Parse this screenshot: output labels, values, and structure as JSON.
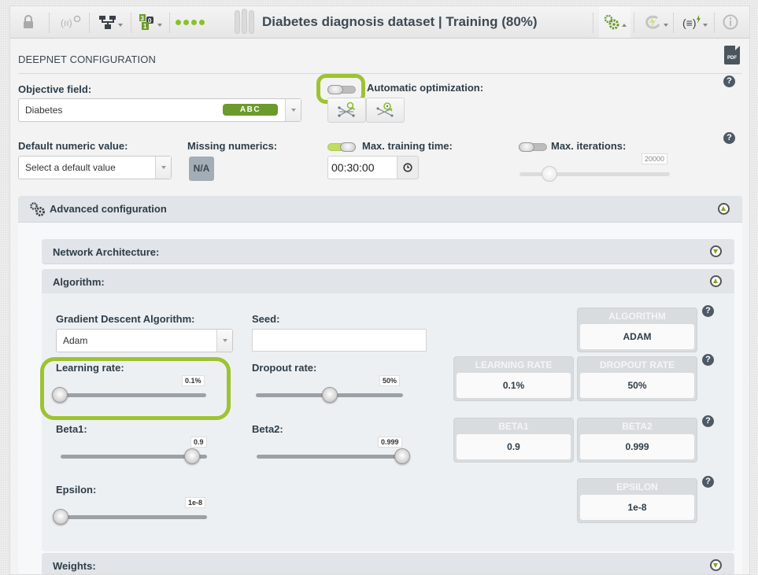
{
  "toolbar": {
    "title": "Diabetes diagnosis dataset | Training (80%)",
    "icons": [
      "lock-icon",
      "model-search-icon",
      "network-icon",
      "counter-icon",
      "progress-dots-icon",
      "loader-icon",
      "gears-icon",
      "lightning-cycle-icon",
      "formula-lightning-icon",
      "info-icon"
    ]
  },
  "config": {
    "section_title": "DEEPNET CONFIGURATION",
    "pdf_label": "PDF",
    "objective_field": {
      "label": "Objective field:",
      "value": "Diabetes",
      "type_badge": "ABC"
    },
    "auto_optimization": {
      "label": "Automatic optimization:",
      "enabled": false
    },
    "default_numeric": {
      "label": "Default numeric value:",
      "placeholder": "Select a default value"
    },
    "missing_numerics": {
      "label": "Missing numerics:",
      "button": "N/A"
    },
    "max_training_time": {
      "label": "Max. training time:",
      "enabled": true,
      "value": "00:30:00"
    },
    "max_iterations": {
      "label": "Max. iterations:",
      "enabled": false,
      "value": "20000",
      "slider_fraction": 0.2
    },
    "help": "?"
  },
  "advanced": {
    "title": "Advanced configuration",
    "network_architecture": "Network Architecture:",
    "algorithm_title": "Algorithm:",
    "weights": "Weights:",
    "gradient_descent": {
      "label": "Gradient Descent Algorithm:",
      "value": "Adam"
    },
    "seed": {
      "label": "Seed:",
      "value": ""
    },
    "learning_rate": {
      "label": "Learning rate:",
      "value": "0.1%",
      "slider_fraction": 0.0
    },
    "dropout_rate": {
      "label": "Dropout rate:",
      "value": "50%",
      "slider_fraction": 0.5
    },
    "beta1": {
      "label": "Beta1:",
      "value": "0.9",
      "slider_fraction": 0.9
    },
    "beta2": {
      "label": "Beta2:",
      "value": "0.999",
      "slider_fraction": 1.0
    },
    "epsilon": {
      "label": "Epsilon:",
      "value": "1e-8",
      "slider_fraction": 0.0
    },
    "summary": {
      "algorithm": {
        "header": "ALGORITHM",
        "value": "ADAM"
      },
      "learning_rate": {
        "header": "LEARNING RATE",
        "value": "0.1%"
      },
      "dropout_rate": {
        "header": "DROPOUT RATE",
        "value": "50%"
      },
      "beta1": {
        "header": "BETA1",
        "value": "0.9"
      },
      "beta2": {
        "header": "BETA2",
        "value": "0.999"
      },
      "epsilon": {
        "header": "EPSILON",
        "value": "1e-8"
      }
    }
  },
  "colors": {
    "accent": "#9dc332",
    "brand_green": "#6d9a2c",
    "dots": "#8cbf2c"
  }
}
